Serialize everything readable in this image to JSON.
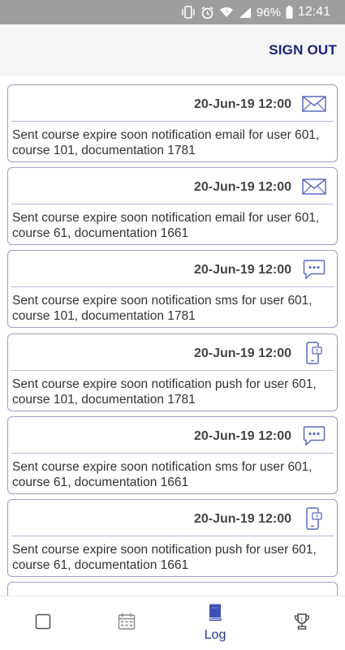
{
  "status_bar": {
    "battery": "96%",
    "time": "12:41",
    "icons": [
      "vibrate-icon",
      "alarm-icon",
      "wifi-icon",
      "signal-icon",
      "battery-icon"
    ]
  },
  "header": {
    "sign_out_label": "SIGN OUT"
  },
  "log_entries": [
    {
      "date": "20-Jun-19 12:00",
      "type": "email-icon",
      "message": "Sent course expire soon notification email for user 601, course 101, documentation 1781"
    },
    {
      "date": "20-Jun-19 12:00",
      "type": "email-icon",
      "message": "Sent course expire soon notification email for user 601, course 61, documentation 1661"
    },
    {
      "date": "20-Jun-19 12:00",
      "type": "sms-icon",
      "message": "Sent course expire soon notification sms for user 601, course 101, documentation 1781"
    },
    {
      "date": "20-Jun-19 12:00",
      "type": "push-icon",
      "message": "Sent course expire soon notification push for user 601, course 101, documentation 1781"
    },
    {
      "date": "20-Jun-19 12:00",
      "type": "sms-icon",
      "message": "Sent course expire soon notification sms for user 601, course 61, documentation 1661"
    },
    {
      "date": "20-Jun-19 12:00",
      "type": "push-icon",
      "message": "Sent course expire soon notification push for user 601, course 61, documentation 1661"
    }
  ],
  "bottom_nav": {
    "items": [
      {
        "icon": "checkbox-icon",
        "label": ""
      },
      {
        "icon": "calendar-icon",
        "label": ""
      },
      {
        "icon": "book-icon",
        "label": "Log"
      },
      {
        "icon": "trophy-icon",
        "label": ""
      }
    ],
    "active_color": "#283593"
  },
  "colors": {
    "accent": "#1a237e",
    "card_border": "#9d9ec9"
  }
}
